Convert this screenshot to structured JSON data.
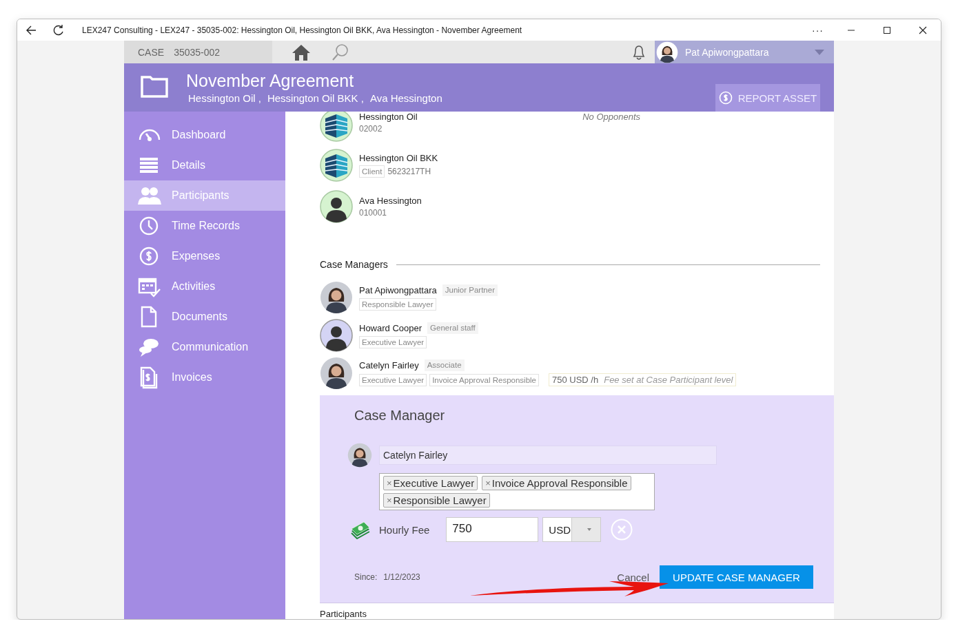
{
  "window": {
    "title": "LEX247 Consulting - LEX247 - 35035-002: Hessington Oil, Hessington Oil BKK, Ava Hessington - November Agreement",
    "more": "···"
  },
  "topbar": {
    "case_label": "CASE",
    "case_number": "35035-002",
    "user_name": "Pat Apiwongpattara"
  },
  "header": {
    "title": "November Agreement",
    "parties": [
      "Hessington Oil ,",
      "Hessington Oil BKK ,",
      "Ava Hessington"
    ],
    "report_button": "REPORT ASSET"
  },
  "sidebar": {
    "items": [
      {
        "label": "Dashboard",
        "selected": false
      },
      {
        "label": "Details",
        "selected": false
      },
      {
        "label": "Participants",
        "selected": true
      },
      {
        "label": "Time Records",
        "selected": false
      },
      {
        "label": "Expenses",
        "selected": false
      },
      {
        "label": "Activities",
        "selected": false
      },
      {
        "label": "Documents",
        "selected": false
      },
      {
        "label": "Communication",
        "selected": false
      },
      {
        "label": "Invoices",
        "selected": false
      }
    ]
  },
  "clients": [
    {
      "name": "Hessington Oil",
      "kind": "company",
      "number": "02002"
    },
    {
      "name": "Hessington Oil BKK",
      "kind": "company",
      "tag": "Client",
      "number": "5623217TH"
    },
    {
      "name": "Ava Hessington",
      "kind": "person",
      "number": "010001"
    }
  ],
  "opponents_note": "No Opponents",
  "case_managers": {
    "heading": "Case Managers",
    "managers": [
      {
        "name": "Pat Apiwongpattara",
        "title": "Junior Partner",
        "roles": [
          "Responsible Lawyer"
        ],
        "kind": "photo"
      },
      {
        "name": "Howard Cooper",
        "title": "General staff",
        "roles": [
          "Executive Lawyer"
        ],
        "kind": "silhouette"
      },
      {
        "name": "Catelyn Fairley",
        "title": "Associate",
        "roles": [
          "Executive Lawyer",
          "Invoice Approval Responsible"
        ],
        "fee": "750 USD /h",
        "fee_note": "Fee set at Case Participant level",
        "kind": "photo"
      }
    ]
  },
  "editor": {
    "heading": "Case Manager",
    "name": "Catelyn Fairley",
    "roles": [
      "Executive Lawyer",
      "Invoice Approval Responsible",
      "Responsible Lawyer"
    ],
    "remove_mark": "×",
    "fee_label": "Hourly Fee",
    "fee": "750",
    "currency": "USD",
    "since_label": "Since:",
    "since": "1/12/2023",
    "cancel": "Cancel",
    "submit": "UPDATE CASE MANAGER"
  },
  "next_section": "Participants"
}
